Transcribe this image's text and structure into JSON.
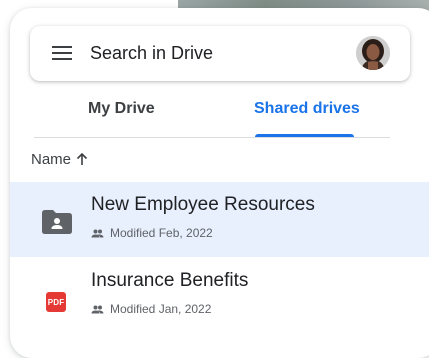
{
  "search": {
    "placeholder": "Search in Drive"
  },
  "tabs": [
    {
      "label": "My Drive",
      "active": false
    },
    {
      "label": "Shared drives",
      "active": true
    }
  ],
  "sort": {
    "label": "Name",
    "direction_icon": "arrow-up-icon"
  },
  "files": [
    {
      "name": "New Employee Resources",
      "meta": "Modified Feb, 2022",
      "icon": "shared-folder-icon",
      "selected": true
    },
    {
      "name": "Insurance Benefits",
      "meta": "Modified Jan, 2022",
      "icon": "pdf-icon",
      "icon_text": "PDF",
      "selected": false
    }
  ],
  "colors": {
    "accent": "#1a73e8",
    "selected_row": "#e8f0fe",
    "pdf_red": "#e53935"
  }
}
